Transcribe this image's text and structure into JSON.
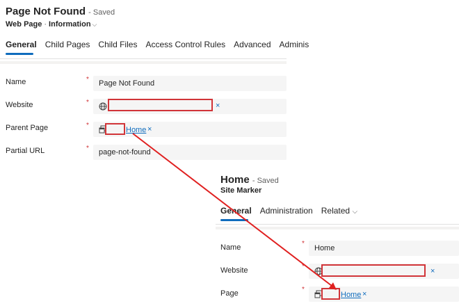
{
  "panel1": {
    "title": "Page Not Found",
    "status": "- Saved",
    "entity": "Web Page",
    "separator": "·",
    "form": "Information",
    "form_chevron": "⌵",
    "tabs": [
      "General",
      "Child Pages",
      "Child Files",
      "Access Control Rules",
      "Advanced",
      "Adminis"
    ],
    "fields": {
      "name": {
        "label": "Name",
        "value": "Page Not Found"
      },
      "website": {
        "label": "Website",
        "value": ""
      },
      "parent_page": {
        "label": "Parent Page",
        "link": "Home"
      },
      "partial_url": {
        "label": "Partial URL",
        "value": "page-not-found"
      }
    }
  },
  "panel2": {
    "title": "Home",
    "status": "- Saved",
    "entity": "Site Marker",
    "tabs": [
      "General",
      "Administration",
      "Related"
    ],
    "related_chevron": "⌵",
    "fields": {
      "name": {
        "label": "Name",
        "value": "Home"
      },
      "website": {
        "label": "Website",
        "value": ""
      },
      "page": {
        "label": "Page",
        "link": "Home"
      }
    }
  },
  "common": {
    "required_mark": "*",
    "clear_mark": "×"
  },
  "colors": {
    "accent": "#0f6cbd",
    "annotation_red": "#d13438",
    "field_bg": "#f5f5f5"
  },
  "icons": {
    "website": "globe-icon",
    "lookup": "record-icon",
    "clear": "close-icon"
  }
}
